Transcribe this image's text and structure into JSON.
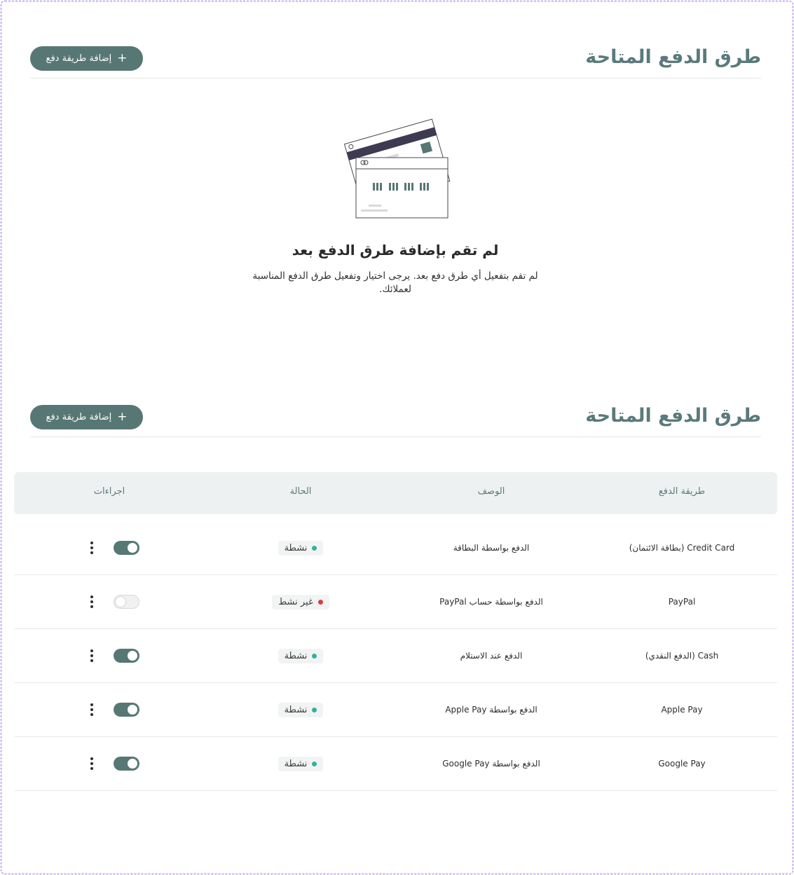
{
  "empty_section": {
    "title": "طرق الدفع المتاحة",
    "add_button_label": "إضافة طريقة دفع",
    "empty_title": "لم تقم بإضافة طرق الدفع بعد",
    "empty_description": "لم تقم بتفعيل أي طرق دفع بعد. يرجى اختيار وتفعيل طرق الدفع المناسبة لعملائك."
  },
  "table_section": {
    "title": "طرق الدفع المتاحة",
    "add_button_label": "إضافة طريقة دفع",
    "columns": {
      "method": "طريقة الدفع",
      "description": "الوصف",
      "status": "الحالة",
      "actions": "اجراءات"
    },
    "rows": [
      {
        "method": "Credit Card (بطاقة الائتمان)",
        "description": "الدفع بواسطة البطاقة",
        "status": "نشطة",
        "active": true
      },
      {
        "method": "PayPal",
        "description": "الدفع بواسطة حساب PayPal",
        "status": "غير نشط",
        "active": false
      },
      {
        "method": "Cash (الدفع النقدي)",
        "description": "الدفع عند الاستلام",
        "status": "نشطة",
        "active": true
      },
      {
        "method": "Apple Pay",
        "description": "الدفع بواسطة Apple Pay",
        "status": "نشطة",
        "active": true
      },
      {
        "method": "Google Pay",
        "description": "الدفع بواسطة Google Pay",
        "status": "نشطة",
        "active": true
      }
    ]
  },
  "colors": {
    "accent": "#577775",
    "title": "#5a7a7b",
    "active_dot": "#2fb3a0",
    "inactive_dot": "#e0393e",
    "table_header_bg": "#eef1f1"
  },
  "icons": {
    "add": "plus-icon",
    "menu": "kebab-menu-icon",
    "illustration": "credit-cards-illustration"
  }
}
